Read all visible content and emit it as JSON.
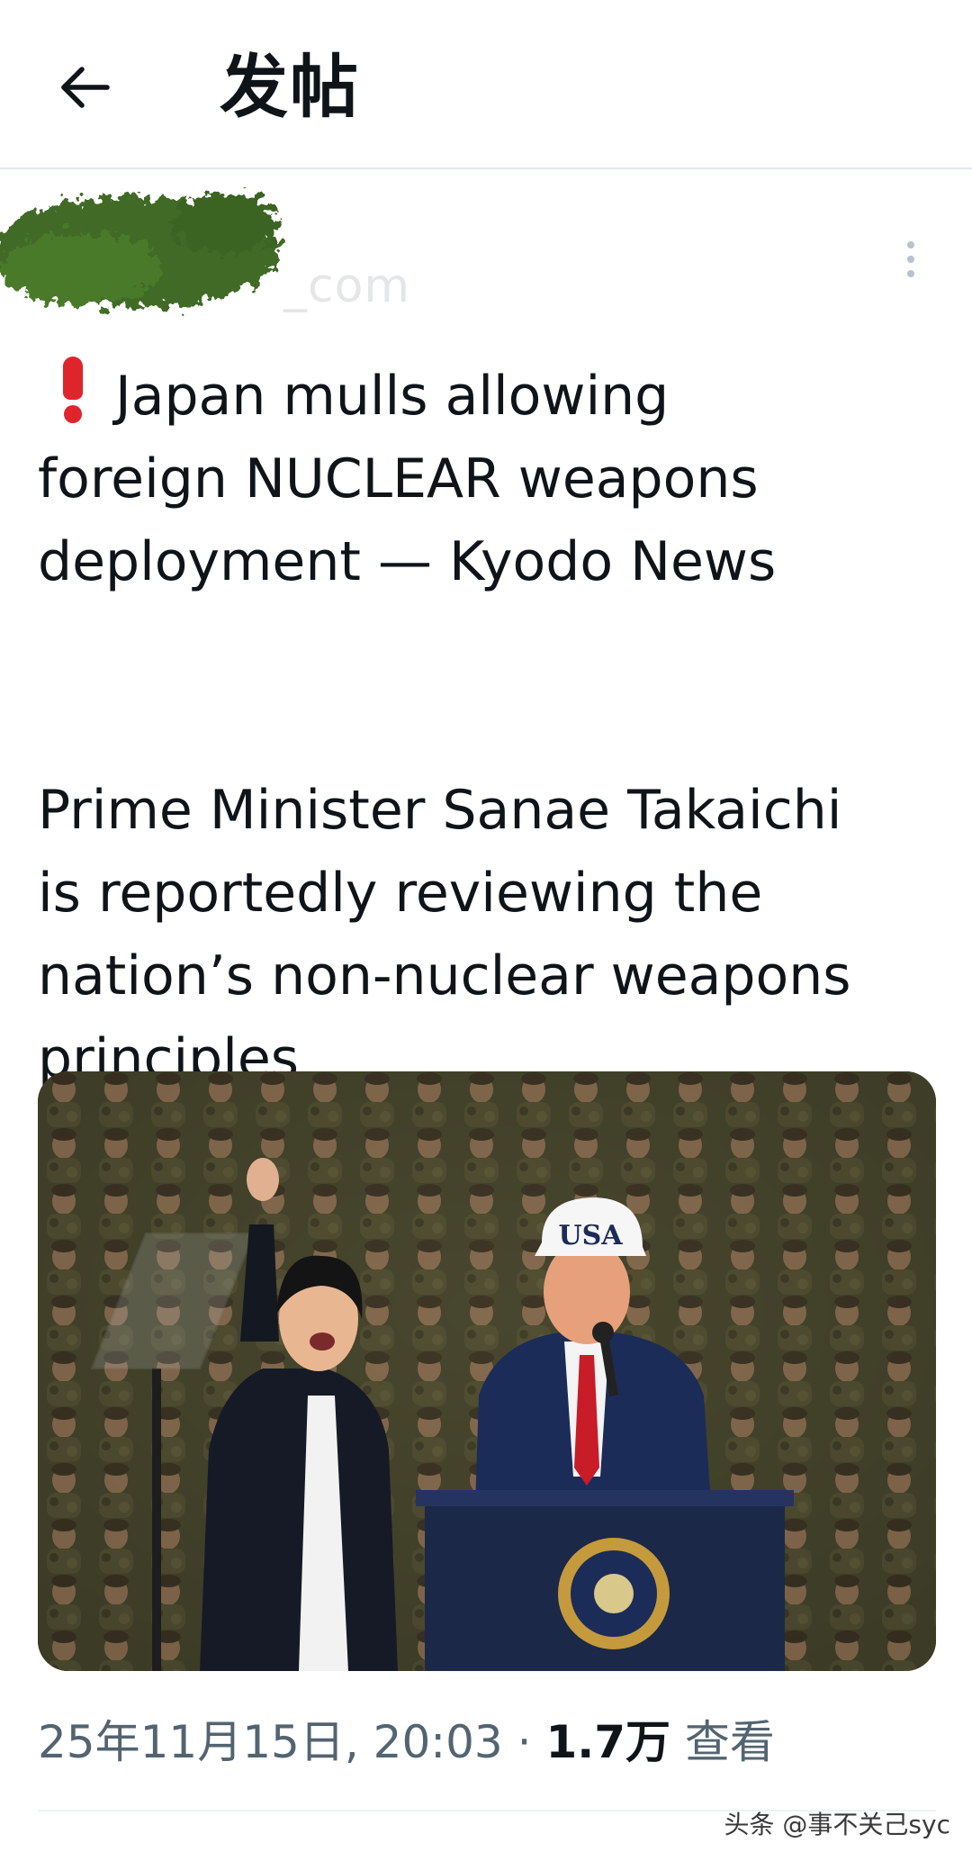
{
  "header": {
    "back_icon": "arrow-left-icon",
    "title": "发帖"
  },
  "author": {
    "handle_fragment": "_com",
    "more_icon": "vertical-ellipsis-icon"
  },
  "tweet": {
    "headline_icon": "red-exclamation-icon",
    "headline_lines": [
      "Japan mulls allowing",
      "foreign NUCLEAR weapons",
      "deployment  — Kyodo News"
    ],
    "body_lines": [
      "Prime Minister Sanae Takaichi",
      "is reportedly reviewing the",
      "nation’s non-nuclear weapons",
      "principles"
    ]
  },
  "media": {
    "cap_text": "USA"
  },
  "meta": {
    "timestamp": "25年11月15日, 20:03",
    "separator": " · ",
    "views_count": "1.7万",
    "views_label": " 查看"
  },
  "watermark": "头条 @事不关己syc",
  "colors": {
    "text_primary": "#0f1419",
    "text_secondary": "#536471",
    "divider": "#e6e9ec",
    "exclamation": "#e0242c",
    "redaction": "#3f6b25"
  }
}
